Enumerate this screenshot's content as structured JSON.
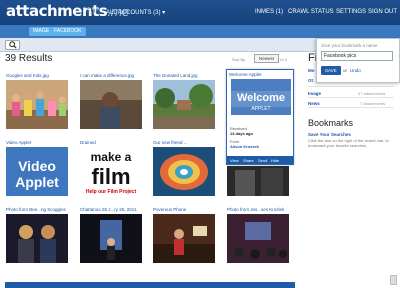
{
  "header": {
    "logo_main": "attachments",
    "logo_suffix": ".me",
    "for_label": "FOR",
    "accounts": "ALL ACCOUNTS (3) ▾",
    "inbox": "INMES (1)",
    "crawl": "CRAWL STATUS",
    "settings": "SETTINGS",
    "signout": "SIGN OUT"
  },
  "filters": {
    "image": "IMAGE",
    "facebook": "FACEBOOK"
  },
  "search": {
    "icon": "search-icon",
    "bookmark_icon": "star-icon"
  },
  "results": {
    "count_label": "39 Results",
    "sort_label": "Sort By",
    "sort_value": "Newest",
    "pager": "1 to 2"
  },
  "thumbs": [
    {
      "title": "Googles and Kids.jpg"
    },
    {
      "title": "I can make a difference.jpg"
    },
    {
      "title": "The Donated Land.jpg"
    },
    {
      "title": "Video Applet"
    },
    {
      "title": "Drained"
    },
    {
      "title": "Our new friend ..."
    },
    {
      "title": "Photo from Bee...ng Scoggins"
    },
    {
      "title": "Chattanoo 26 J...ry 26, 2011"
    },
    {
      "title": "Poverous Phone"
    },
    {
      "title": "Photo from Jes...ses Krozlek"
    },
    {
      "title": "Welcome Applet"
    }
  ],
  "thumb_art": {
    "film_make": "make a",
    "film_word": "film",
    "film_sub": "Help our Film Project",
    "video_1": "Video",
    "video_2": "Applet",
    "welcome_1": "Welcome",
    "welcome_2": "APPLET"
  },
  "callout": {
    "received_label": "Received",
    "received_value": "13 days ago",
    "from_label": "From",
    "from_value": "Alison Kroszek",
    "actions": [
      "View",
      "Share",
      "Send",
      "Hide"
    ]
  },
  "sidebar": {
    "filter_heading": "Fi",
    "rows": [
      {
        "label": "Mo",
        "value": ""
      },
      {
        "label": "Ot",
        "value": ""
      },
      {
        "label": "Image",
        "value": "47 attachments"
      },
      {
        "label": "News",
        "value": "7 attachments"
      }
    ],
    "bookmarks_heading": "Bookmarks",
    "save_title": "Save Your Searches",
    "save_desc": "Click the star on the right of the search bar, to bookmark your favorite searches."
  },
  "bookmark_popup": {
    "prompt": "Give your bookmark a name",
    "value": "Facebook pics",
    "save": "SAVE",
    "or": "or",
    "undo": "Undo"
  }
}
